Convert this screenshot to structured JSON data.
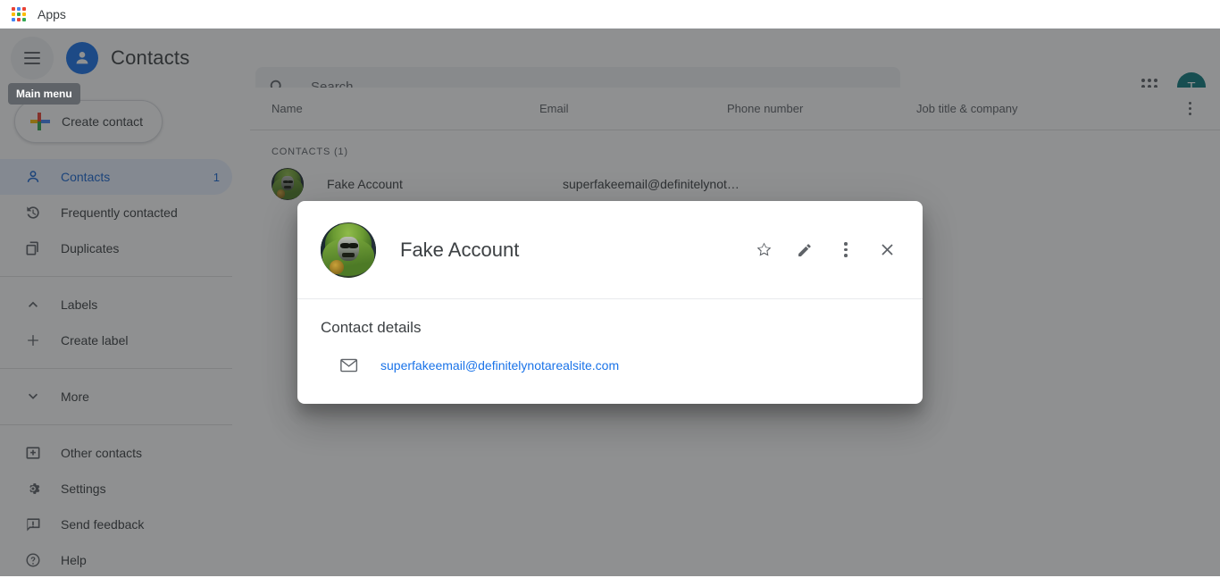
{
  "browser": {
    "apps_label": "Apps",
    "apps_icon": "apps-grid-icon"
  },
  "header": {
    "menu_icon": "hamburger-icon",
    "menu_tooltip": "Main menu",
    "brand_icon": "person-circle-icon",
    "brand_title": "Contacts",
    "waffle_icon": "google-apps-waffle-icon",
    "account_initial": "T",
    "account_color": "#0f7a7f"
  },
  "search": {
    "icon": "search-icon",
    "placeholder": "Search",
    "value": ""
  },
  "sidebar": {
    "create_contact": {
      "label": "Create contact",
      "icon": "plus-icon"
    },
    "items": [
      {
        "label": "Contacts",
        "icon": "person-outline-icon",
        "count": "1",
        "active": true
      },
      {
        "label": "Frequently contacted",
        "icon": "history-clock-icon",
        "count": "",
        "active": false
      },
      {
        "label": "Duplicates",
        "icon": "copy-pages-icon",
        "count": "",
        "active": false
      }
    ],
    "labels_section": [
      {
        "label": "Labels",
        "icon": "chevron-up-icon"
      },
      {
        "label": "Create label",
        "icon": "plus-thin-icon"
      }
    ],
    "more_section": [
      {
        "label": "More",
        "icon": "chevron-down-icon"
      }
    ],
    "bottom_items": [
      {
        "label": "Other contacts",
        "icon": "archive-box-icon"
      },
      {
        "label": "Settings",
        "icon": "gear-icon"
      },
      {
        "label": "Send feedback",
        "icon": "feedback-icon"
      },
      {
        "label": "Help",
        "icon": "help-circle-icon"
      }
    ]
  },
  "table": {
    "columns": [
      "Name",
      "Email",
      "Phone number",
      "Job title & company"
    ],
    "overflow_icon": "more-vertical-icon",
    "section_label": "CONTACTS (1)",
    "rows": [
      {
        "avatar": "doom-avatar",
        "name": "Fake Account",
        "email": "superfakeemail@definitelynot…",
        "phone": "",
        "job": ""
      }
    ]
  },
  "modal": {
    "avatar": "doom-avatar",
    "title": "Fake Account",
    "actions": [
      {
        "name": "star-icon",
        "label": "Favorite"
      },
      {
        "name": "pencil-icon",
        "label": "Edit"
      },
      {
        "name": "more-vertical-icon",
        "label": "More actions"
      },
      {
        "name": "close-icon",
        "label": "Close"
      }
    ],
    "details_title": "Contact details",
    "details": [
      {
        "icon": "mail-icon",
        "value": "superfakeemail@definitelynotarealsite.com",
        "type": "email"
      }
    ]
  },
  "colors": {
    "brand_blue": "#1a73e8",
    "active_pill": "#e8f0fe",
    "active_text": "#1967d2",
    "link": "#1a73e8",
    "scrim": "rgba(32,33,36,0.5)",
    "tooltip_bg": "#5f6368"
  }
}
